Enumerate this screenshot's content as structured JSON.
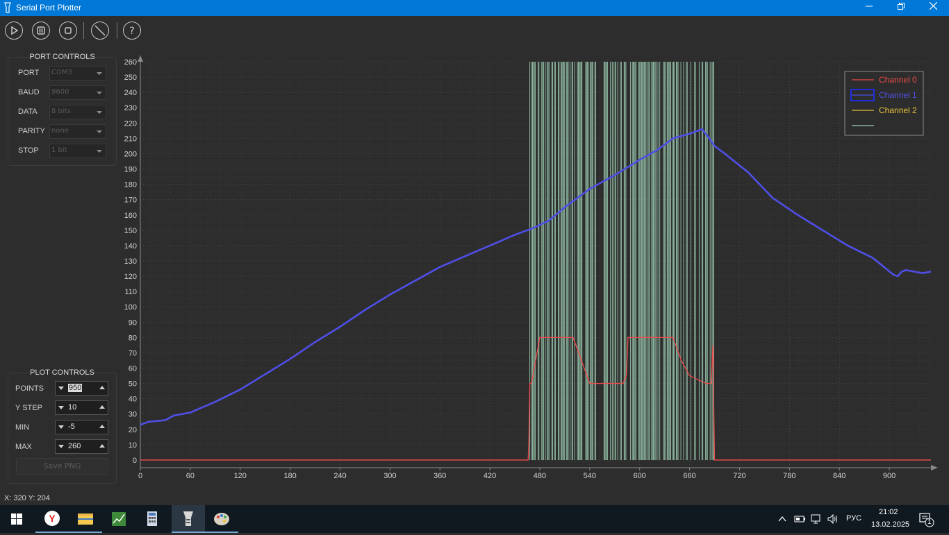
{
  "window": {
    "title": "Serial Port Plotter"
  },
  "toolbar": {
    "buttons": [
      {
        "name": "play-button",
        "icon": "play-icon"
      },
      {
        "name": "pause-button",
        "icon": "pause-icon"
      },
      {
        "name": "stop-button",
        "icon": "stop-icon"
      },
      {
        "name": "clear-button",
        "icon": "no-entry-icon"
      },
      {
        "name": "help-button",
        "icon": "help-icon"
      }
    ]
  },
  "port_controls": {
    "title": "PORT CONTROLS",
    "fields": [
      {
        "label": "PORT",
        "value": "COM3"
      },
      {
        "label": "BAUD",
        "value": "9600"
      },
      {
        "label": "DATA",
        "value": "8 bits"
      },
      {
        "label": "PARITY",
        "value": "none"
      },
      {
        "label": "STOP",
        "value": "1 bit"
      }
    ]
  },
  "plot_controls": {
    "title": "PLOT CONTROLS",
    "fields": [
      {
        "label": "POINTS",
        "value": "950"
      },
      {
        "label": "Y STEP",
        "value": "10"
      },
      {
        "label": "MIN",
        "value": "-5"
      },
      {
        "label": "MAX",
        "value": "260"
      }
    ],
    "save_label": "Save PNG"
  },
  "status": {
    "coords": "X: 320 Y: 204"
  },
  "taskbar": {
    "lang": "РУС",
    "time": "21:02",
    "date": "13.02.2025",
    "notification_count": "1"
  },
  "colors": {
    "background": "#2d2d2d",
    "plot_bg": "#2d2d2d",
    "grid": "#5a5a5a",
    "channel0": "#ef4a4a",
    "channel1": "#4f4fe8",
    "channel2": "#e8c23a",
    "channel3": "#9fd1b5"
  },
  "chart_data": {
    "type": "line",
    "title": "",
    "xlabel": "",
    "ylabel": "",
    "xlim": [
      0,
      950
    ],
    "ylim": [
      -5,
      260
    ],
    "x_ticks": [
      "0",
      "60",
      "120",
      "180",
      "240",
      "300",
      "360",
      "420",
      "480",
      "540",
      "600",
      "660",
      "720",
      "780",
      "840",
      "900"
    ],
    "y_ticks": [
      "0",
      "10",
      "20",
      "30",
      "40",
      "50",
      "60",
      "70",
      "80",
      "90",
      "100",
      "110",
      "120",
      "130",
      "140",
      "150",
      "160",
      "170",
      "180",
      "190",
      "200",
      "210",
      "220",
      "230",
      "240",
      "250",
      "260"
    ],
    "grid": true,
    "legend_position": "top-right",
    "legend": [
      "Channel 0",
      "Channel 1",
      "Channel 2",
      ""
    ],
    "series": [
      {
        "name": "Channel 0",
        "color": "#ef4a4a",
        "x": [
          0,
          466,
          467,
          468,
          470,
          480,
          490,
          500,
          520,
          530,
          540,
          560,
          580,
          584,
          586,
          600,
          620,
          640,
          650,
          660,
          680,
          686,
          688,
          690,
          950
        ],
        "y": [
          0,
          0,
          15,
          50,
          50,
          80,
          80,
          80,
          80,
          65,
          50,
          50,
          50,
          55,
          80,
          80,
          80,
          80,
          65,
          55,
          50,
          50,
          75,
          0,
          0
        ]
      },
      {
        "name": "Channel 1",
        "color": "#4f4fe8",
        "x": [
          0,
          10,
          30,
          40,
          60,
          90,
          120,
          150,
          180,
          210,
          240,
          270,
          300,
          330,
          360,
          390,
          420,
          450,
          470,
          490,
          510,
          540,
          570,
          600,
          620,
          640,
          660,
          675,
          685,
          690,
          700,
          730,
          760,
          790,
          820,
          850,
          880,
          905,
          910,
          915,
          920,
          940,
          950
        ],
        "y": [
          23,
          25,
          26,
          29,
          31,
          38,
          46,
          56,
          66,
          77,
          87,
          98,
          108,
          117,
          126,
          133,
          140,
          147,
          151,
          156,
          165,
          177,
          186,
          196,
          202,
          210,
          213,
          216,
          209,
          205,
          201,
          188,
          171,
          160,
          150,
          140,
          132,
          121,
          120,
          123,
          124,
          122,
          123
        ]
      },
      {
        "name": "Channel 2",
        "color": "#e8c23a",
        "x": [],
        "y": []
      },
      {
        "name": "",
        "color": "#9fd1b5",
        "note_only_visual": true,
        "x": [
          468,
          690
        ],
        "y": [
          0,
          260
        ]
      }
    ]
  }
}
